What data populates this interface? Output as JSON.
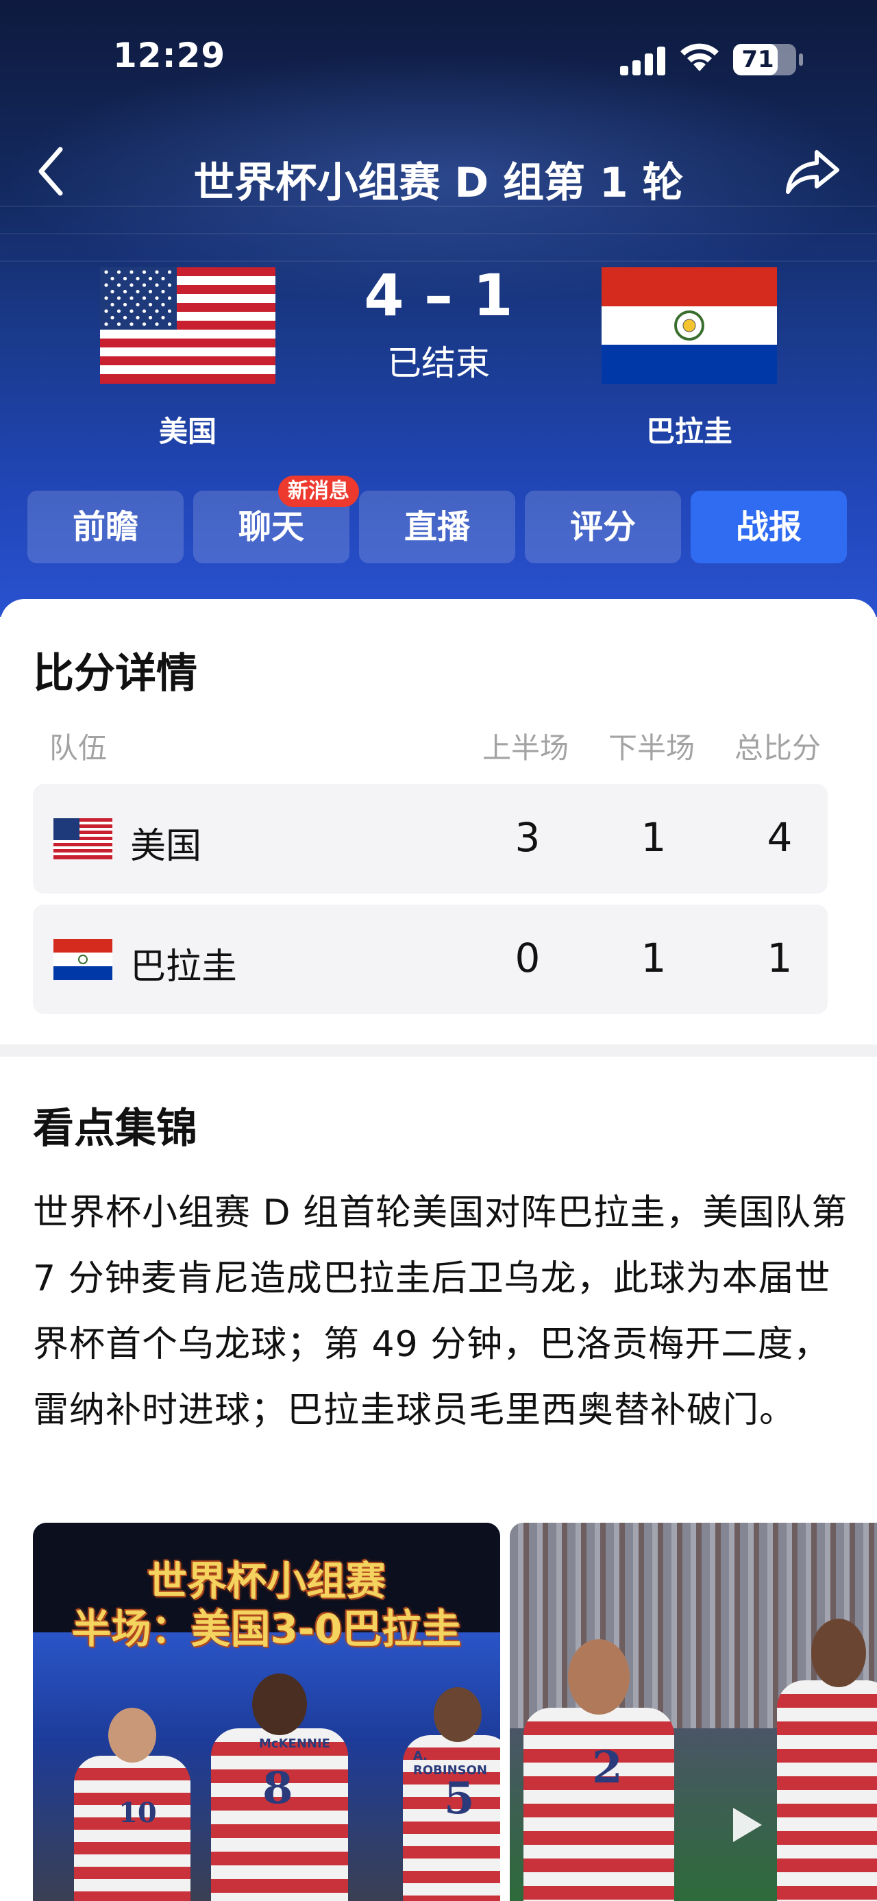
{
  "status_bar": {
    "time": "12:29",
    "battery": "71",
    "battery_level": 0.71
  },
  "header": {
    "title": "世界杯小组赛 D 组第 1 轮"
  },
  "match": {
    "score": "4 – 1",
    "status": "已结束",
    "home_team": "美国",
    "away_team": "巴拉圭"
  },
  "tabs": [
    {
      "label": "前瞻",
      "active": false
    },
    {
      "label": "聊天",
      "active": false
    },
    {
      "label": "直播",
      "active": false
    },
    {
      "label": "评分",
      "active": false
    },
    {
      "label": "战报",
      "active": true
    }
  ],
  "chat_badge": "新消息",
  "score_details": {
    "title": "比分详情",
    "headers": [
      "队伍",
      "上半场",
      "下半场",
      "总比分"
    ],
    "rows": [
      {
        "team": "美国",
        "first_half": "3",
        "second_half": "1",
        "total": "4"
      },
      {
        "team": "巴拉圭",
        "first_half": "0",
        "second_half": "1",
        "total": "1"
      }
    ]
  },
  "highlights": {
    "title": "看点集锦",
    "text": "世界杯小组赛 D 组首轮美国对阵巴拉圭，美国队第 7 分钟麦肯尼造成巴拉圭后卫乌龙，此球为本届世界杯首个乌龙球；第 49 分钟，巴洛贡梅开二度，雷纳补时进球；巴拉圭球员毛里西奥替补破门。",
    "media": [
      {
        "overlay_line1": "世界杯小组赛",
        "overlay_line2": "半场：美国3-0巴拉圭"
      },
      {
        "has_play_button": true
      }
    ]
  },
  "colors": {
    "accent": "#2f6cf2",
    "badge": "#ee3a2e",
    "hero_dark": "#0e1a3e",
    "hero_light": "#2a52d0"
  }
}
